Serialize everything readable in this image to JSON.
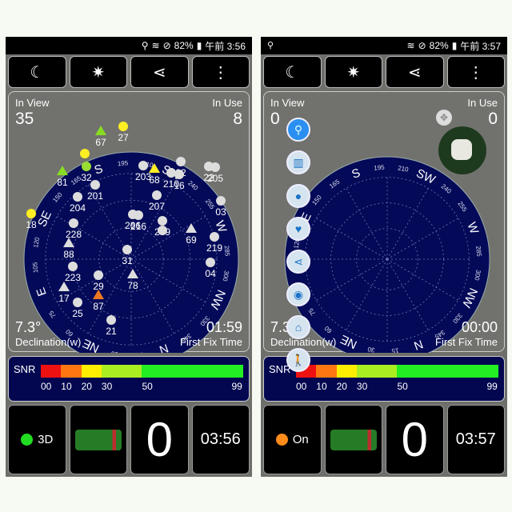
{
  "panels": [
    {
      "status": {
        "left_icon": "",
        "icons": [
          "location-icon",
          "wifi-icon",
          "alarm-icon"
        ],
        "battery": "82%",
        "time": "午前 3:56"
      },
      "toolbar": [
        {
          "icon": "moon-icon",
          "glyph": "☾"
        },
        {
          "icon": "sun-icon",
          "glyph": "✷"
        },
        {
          "icon": "share-icon",
          "glyph": "⋖"
        },
        {
          "icon": "more-vert-icon",
          "glyph": "⋮"
        }
      ],
      "in_view_label": "In View",
      "in_view": "35",
      "in_use_label": "In Use",
      "in_use": "8",
      "declination": "7.3°",
      "declination_label": "Declination(w)",
      "first_fix": "01:59",
      "first_fix_label": "First Fix Time",
      "fix_status": "3D",
      "fix_color": "#22dd22",
      "count": "0",
      "clock": "03:56",
      "satellites": [
        {
          "id": "67",
          "shape": "triangle",
          "color": "#88dd22"
        },
        {
          "id": "27",
          "shape": "circle",
          "color": "#ffee22"
        },
        {
          "id": "",
          "shape": "circle",
          "color": "#ffee22"
        },
        {
          "id": "32",
          "shape": "circle",
          "color": "#99dd33"
        },
        {
          "id": "81",
          "shape": "triangle",
          "color": "#88dd22"
        },
        {
          "id": "18",
          "shape": "circle",
          "color": "#ffee22"
        },
        {
          "id": "201",
          "shape": "circle",
          "color": "#dddddd"
        },
        {
          "id": "204",
          "shape": "circle",
          "color": "#dddddd"
        },
        {
          "id": "203",
          "shape": "circle",
          "color": "#dddddd"
        },
        {
          "id": "68",
          "shape": "triangle",
          "color": "#ffee22"
        },
        {
          "id": "22",
          "shape": "circle",
          "color": "#dddddd"
        },
        {
          "id": "210",
          "shape": "circle",
          "color": "#dddddd"
        },
        {
          "id": "16",
          "shape": "circle",
          "color": "#dddddd"
        },
        {
          "id": "22",
          "shape": "circle",
          "color": "#dddddd"
        },
        {
          "id": "205",
          "shape": "circle",
          "color": "#dddddd"
        },
        {
          "id": "03",
          "shape": "circle",
          "color": "#dddddd"
        },
        {
          "id": "207",
          "shape": "circle",
          "color": "#dddddd"
        },
        {
          "id": "266",
          "shape": "circle",
          "color": "#dddddd"
        },
        {
          "id": "216",
          "shape": "circle",
          "color": "#dddddd"
        },
        {
          "id": "209",
          "shape": "circle",
          "color": "#dddddd"
        },
        {
          "id": "",
          "shape": "circle",
          "color": "#dddddd"
        },
        {
          "id": "69",
          "shape": "triangle",
          "color": "#dddddd"
        },
        {
          "id": "219",
          "shape": "circle",
          "color": "#dddddd"
        },
        {
          "id": "04",
          "shape": "circle",
          "color": "#dddddd"
        },
        {
          "id": "228",
          "shape": "circle",
          "color": "#dddddd"
        },
        {
          "id": "88",
          "shape": "triangle",
          "color": "#dddddd"
        },
        {
          "id": "31",
          "shape": "circle",
          "color": "#dddddd"
        },
        {
          "id": "78",
          "shape": "triangle",
          "color": "#dddddd"
        },
        {
          "id": "223",
          "shape": "circle",
          "color": "#dddddd"
        },
        {
          "id": "29",
          "shape": "circle",
          "color": "#dddddd"
        },
        {
          "id": "87",
          "shape": "triangle",
          "color": "#ee7722"
        },
        {
          "id": "17",
          "shape": "triangle",
          "color": "#dddddd"
        },
        {
          "id": "25",
          "shape": "circle",
          "color": "#dddddd"
        },
        {
          "id": "21",
          "shape": "circle",
          "color": "#dddddd"
        }
      ]
    },
    {
      "status": {
        "left_icon": "gps-icon",
        "icons": [
          "wifi-icon",
          "alarm-icon"
        ],
        "battery": "82%",
        "time": "午前 3:57"
      },
      "toolbar": [
        {
          "icon": "moon-icon",
          "glyph": "☾"
        },
        {
          "icon": "sun-icon",
          "glyph": "✷"
        },
        {
          "icon": "share-icon",
          "glyph": "⋖"
        },
        {
          "icon": "more-vert-icon",
          "glyph": "⋮"
        }
      ],
      "in_view_label": "In View",
      "in_view": "0",
      "in_use_label": "In Use",
      "in_use": "0",
      "declination": "7.3",
      "declination_label": "Declination(w)",
      "first_fix": "00:00",
      "first_fix_label": "First Fix Time",
      "fix_status": "On",
      "fix_color": "#ff8c1a",
      "count": "0",
      "clock": "03:57",
      "fab_menu": [
        "map-pin-icon",
        "map-icon",
        "location-icon",
        "heart-icon",
        "share-icon",
        "eye-icon",
        "lock-icon",
        "walk-icon"
      ],
      "satellites": []
    }
  ],
  "compass": {
    "points": [
      [
        "N",
        0
      ],
      [
        "NE",
        45
      ],
      [
        "E",
        90
      ],
      [
        "SE",
        135
      ],
      [
        "S",
        180
      ],
      [
        "SW",
        225
      ],
      [
        "W",
        270
      ],
      [
        "NW",
        315
      ]
    ],
    "degrees": [
      "15",
      "30",
      "60",
      "75",
      "105",
      "120",
      "150",
      "165",
      "195",
      "210",
      "240",
      "255",
      "285",
      "300",
      "330",
      "345"
    ]
  },
  "snr": {
    "label": "SNR",
    "ticks": [
      "00",
      "10",
      "20",
      "30",
      "50",
      "99"
    ],
    "segments": [
      {
        "color": "#ee1111"
      },
      {
        "color": "#ff7711"
      },
      {
        "color": "#ffee00"
      },
      {
        "color": "#aaee22"
      },
      {
        "color": "#22ee22"
      }
    ]
  }
}
